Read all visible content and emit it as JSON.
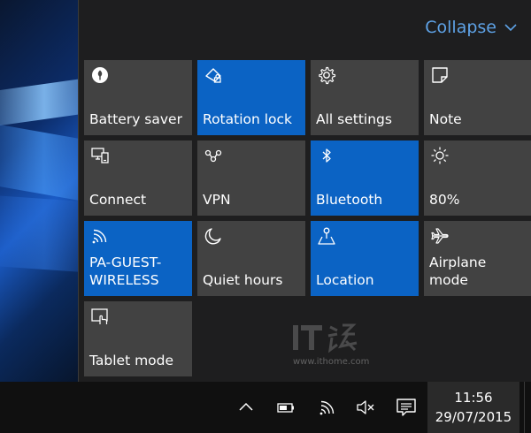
{
  "action_center": {
    "collapse_label": "Collapse",
    "accent_color": "#0b63c4",
    "tiles": [
      {
        "label": "Battery saver",
        "icon": "battery-saver-icon",
        "active": false
      },
      {
        "label": "Rotation lock",
        "icon": "rotation-lock-icon",
        "active": true
      },
      {
        "label": "All settings",
        "icon": "settings-gear-icon",
        "active": false
      },
      {
        "label": "Note",
        "icon": "note-icon",
        "active": false
      },
      {
        "label": "Connect",
        "icon": "connect-icon",
        "active": false
      },
      {
        "label": "VPN",
        "icon": "vpn-icon",
        "active": false
      },
      {
        "label": "Bluetooth",
        "icon": "bluetooth-icon",
        "active": true
      },
      {
        "label": "80%",
        "icon": "brightness-icon",
        "active": false
      },
      {
        "label": "PA-GUEST-WIRELESS",
        "icon": "wifi-icon",
        "active": true
      },
      {
        "label": "Quiet hours",
        "icon": "moon-icon",
        "active": false
      },
      {
        "label": "Location",
        "icon": "location-icon",
        "active": true
      },
      {
        "label": "Airplane mode",
        "icon": "airplane-icon",
        "active": false
      },
      {
        "label": "Tablet mode",
        "icon": "tablet-mode-icon",
        "active": false
      }
    ]
  },
  "watermark": {
    "logo_text": "IT之家",
    "url": "www.ithome.com"
  },
  "taskbar": {
    "tray_icons": [
      "chevron-up-icon",
      "battery-icon",
      "wifi-icon",
      "volume-muted-icon"
    ],
    "action_center_icon": "action-center-icon",
    "time": "11:56",
    "date": "29/07/2015"
  }
}
